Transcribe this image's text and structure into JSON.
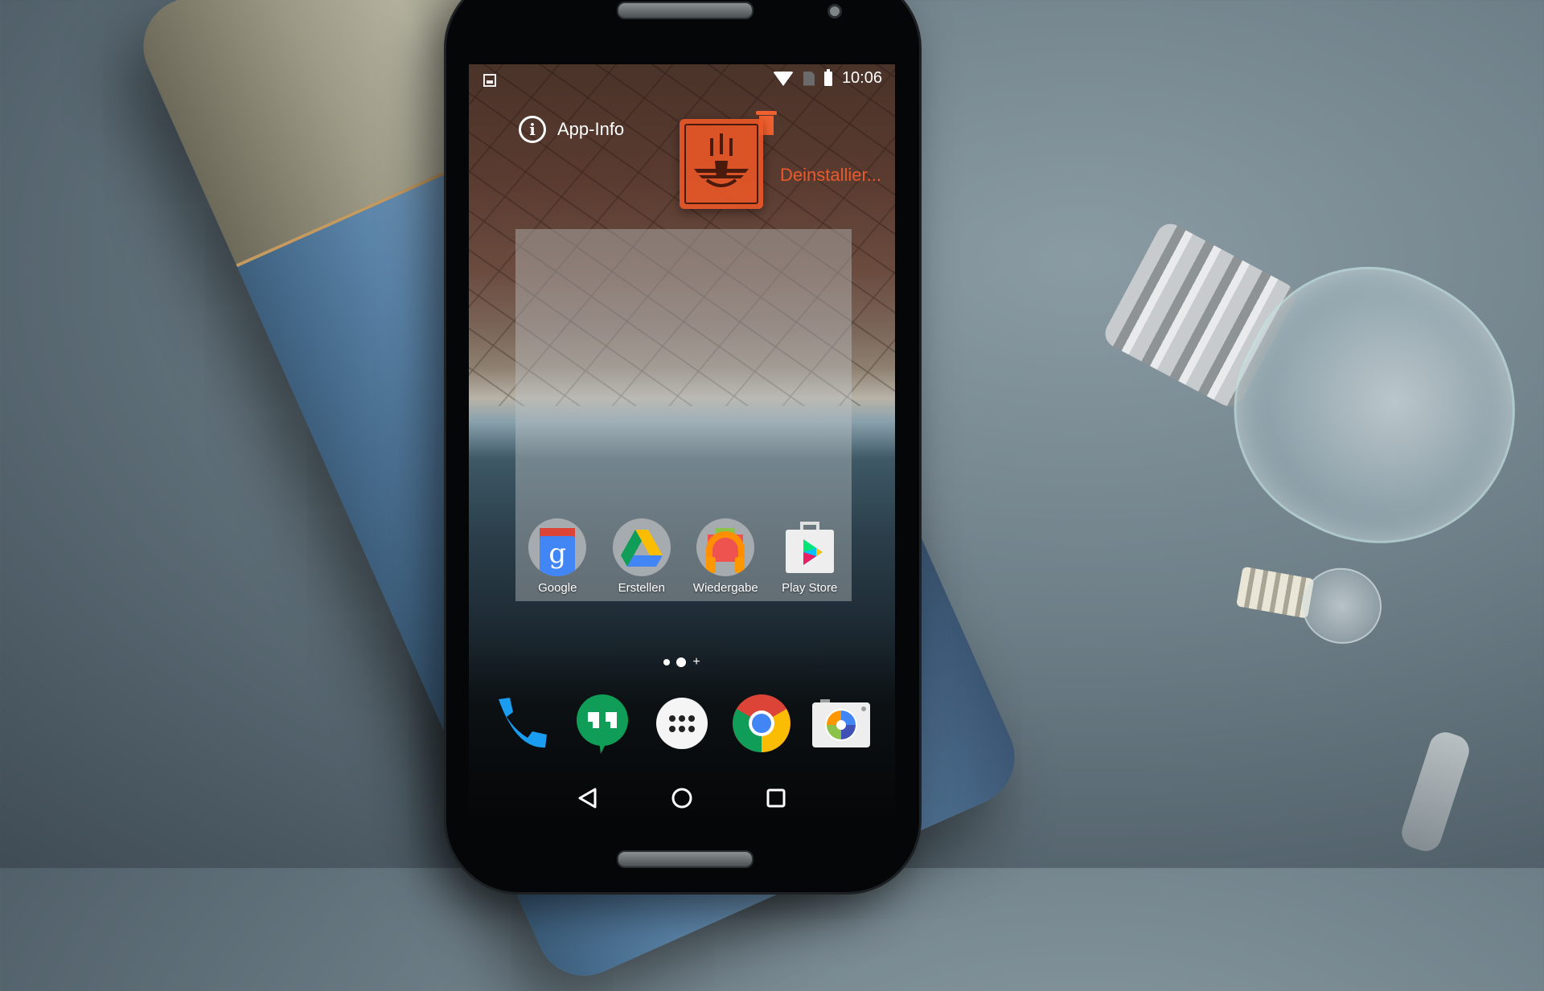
{
  "status_bar": {
    "notification_icon": "image-icon",
    "icons": [
      "wifi-icon",
      "no-sim-icon",
      "battery-icon"
    ],
    "time": "10:06"
  },
  "drop_targets": {
    "app_info_label": "App-Info",
    "uninstall_label": "Deinstallier...",
    "uninstall_color": "#E85A2C"
  },
  "dragged_app": {
    "icon": "winged-emblem-icon",
    "color": "#E95828"
  },
  "folder": {
    "apps": [
      {
        "label": "Google",
        "icon": "google-icon"
      },
      {
        "label": "Erstellen",
        "icon": "google-drive-icon"
      },
      {
        "label": "Wiedergabe",
        "icon": "play-music-icon"
      },
      {
        "label": "Play Store",
        "icon": "play-store-icon"
      }
    ]
  },
  "page_indicator": {
    "pages": 2,
    "current": 2,
    "add_symbol": "+"
  },
  "dock": {
    "apps": [
      {
        "name": "Phone",
        "icon": "phone-icon"
      },
      {
        "name": "Hangouts",
        "icon": "hangouts-icon"
      },
      {
        "name": "Apps",
        "icon": "app-drawer-icon"
      },
      {
        "name": "Chrome",
        "icon": "chrome-icon"
      },
      {
        "name": "Camera",
        "icon": "camera-icon"
      }
    ]
  },
  "nav_bar": {
    "buttons": [
      "back-icon",
      "home-icon",
      "recents-icon"
    ]
  }
}
